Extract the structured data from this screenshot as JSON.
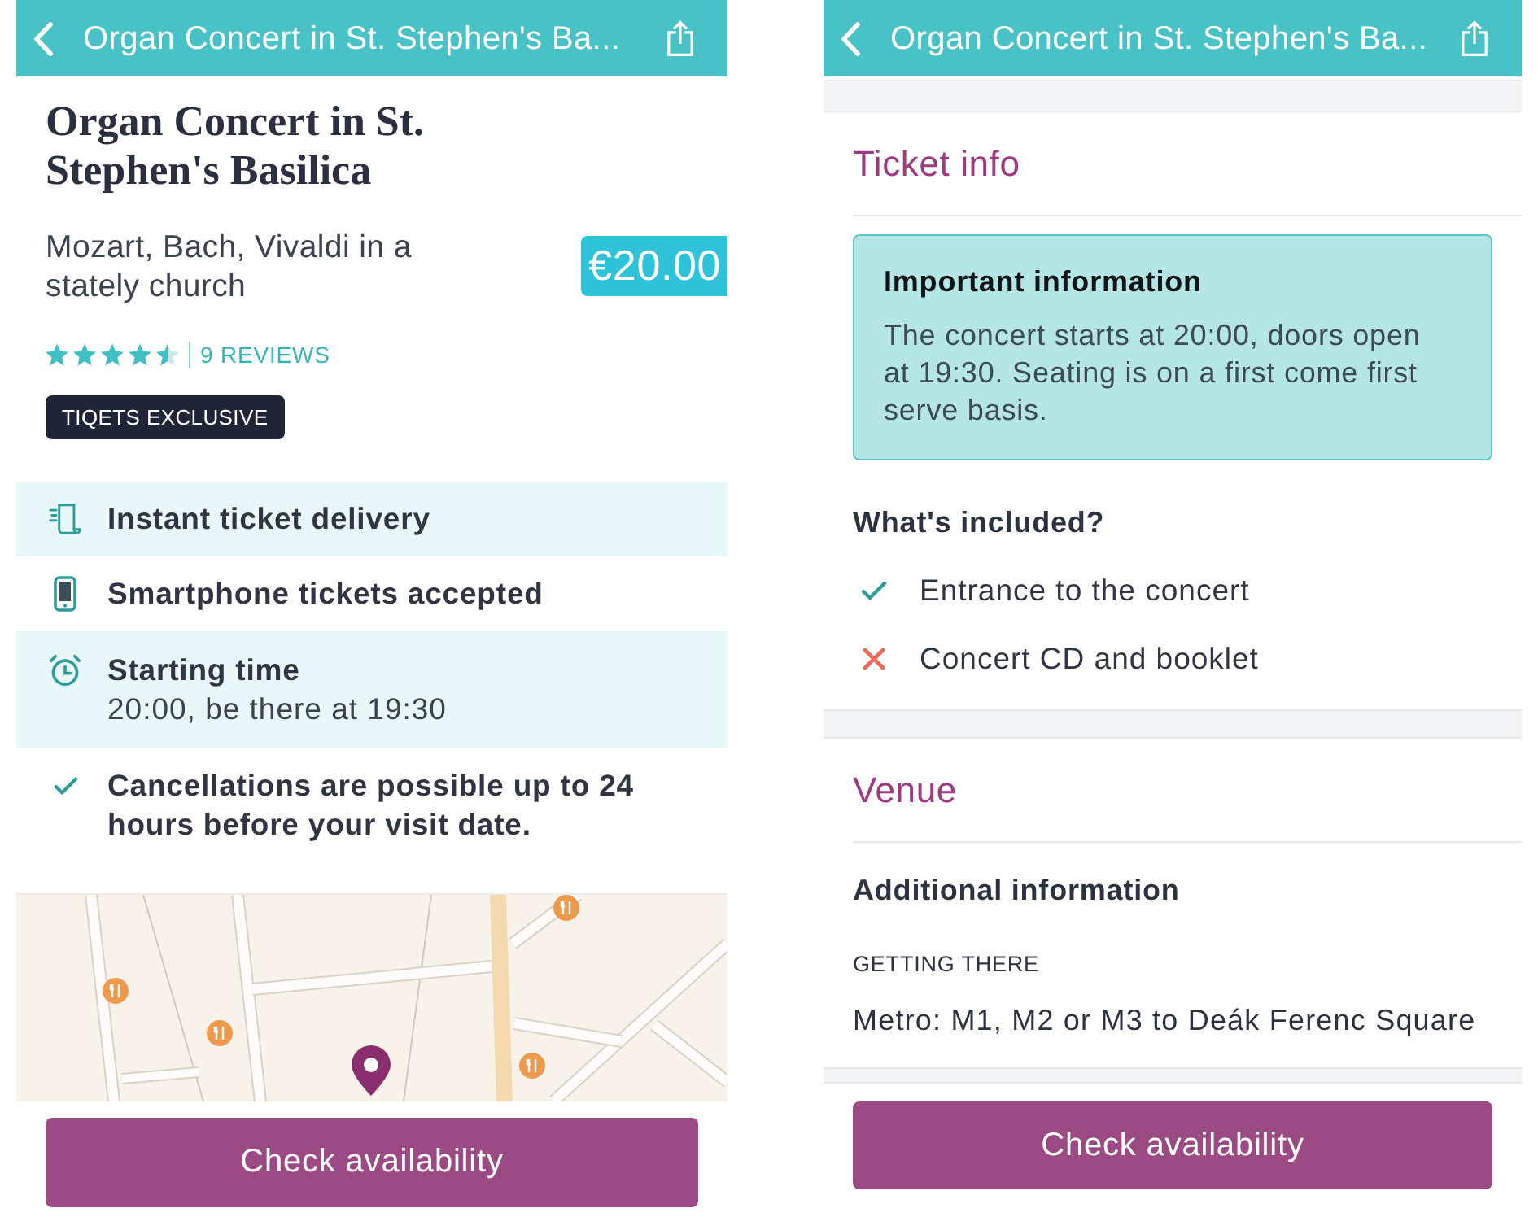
{
  "left_screen": {
    "header": {
      "title": "Organ Concert in St. Stephen's Ba..."
    },
    "title": "Organ Concert in St. Stephen's Basilica",
    "subtitle": "Mozart, Bach, Vivaldi in a stately church",
    "price": "€20.00",
    "rating": {
      "stars": 4.5,
      "reviews": "9 REVIEWS"
    },
    "badge": "TIQETS EXCLUSIVE",
    "features": [
      {
        "kind": "ticket",
        "title": "Instant ticket delivery"
      },
      {
        "kind": "smartphone",
        "title": "Smartphone tickets accepted"
      },
      {
        "kind": "clock",
        "title": "Starting time",
        "detail": "20:00, be there at 19:30"
      },
      {
        "kind": "check",
        "title": "Cancellations are possible up to 24 hours before your visit date."
      }
    ],
    "button": "Check availability"
  },
  "right_screen": {
    "header": {
      "title": "Organ Concert in St. Stephen's Ba..."
    },
    "ticket_info": {
      "heading": "Ticket info",
      "notice": {
        "title": "Important information",
        "text": "The concert starts at 20:00, doors open at 19:30. Seating is on a first come first serve basis."
      },
      "included_heading": "What's included?",
      "included": [
        {
          "label": "Entrance to the concert",
          "included": true
        },
        {
          "label": "Concert CD and booklet",
          "included": false
        }
      ]
    },
    "venue": {
      "heading": "Venue",
      "subheading": "Additional information",
      "label": "GETTING THERE",
      "text": "Metro: M1, M2 or M3 to Deák Ferenc Square"
    },
    "button": "Check availability"
  }
}
